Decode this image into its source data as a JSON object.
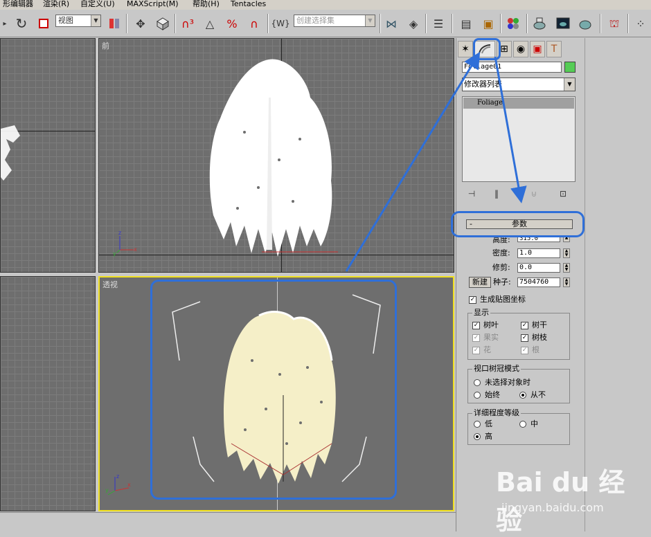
{
  "menubar": {
    "items": [
      "形编辑器",
      "渲染(R)",
      "自定义(U)",
      "MAXScript(M)",
      "帮助(H)",
      "Tentacles"
    ]
  },
  "toolbar": {
    "view_combo": "视图",
    "selection_set_placeholder": "创建选择集",
    "icons": [
      "undo-icon",
      "select-icon",
      "select-by-name-icon",
      "move-icon",
      "rotate-icon",
      "snap-3d-icon",
      "angle-snap-icon",
      "percent-snap-icon",
      "spinner-snap-icon",
      "named-selection-icon",
      "mirror-icon",
      "align-icon",
      "layer-icon",
      "curve-editor-icon",
      "schematic-icon",
      "material-editor-icon",
      "render-setup-icon",
      "render-frame-icon",
      "quick-render-icon",
      "hierarchy-icon",
      "particles-icon"
    ]
  },
  "viewports": {
    "front_label": "前",
    "perspective_label": "透视",
    "active_border_color": "#f0e020",
    "axis_labels": {
      "x": "x",
      "y": "y",
      "z": "z"
    }
  },
  "command_panel": {
    "tabs": [
      "create-tab-icon",
      "modify-tab-icon",
      "hierarchy-tab-icon",
      "motion-tab-icon",
      "display-tab-icon",
      "utilities-tab-icon"
    ],
    "object_name": "Foliage01",
    "object_color": "#55cc55",
    "modifier_list_label": "修改器列表",
    "stack_item": "Foliage",
    "rollout_title": "参数",
    "rollout_minus": "-",
    "params": {
      "height_label": "高度:",
      "height_value": "315.0",
      "density_label": "密度:",
      "density_value": "1.0",
      "pruning_label": "修剪:",
      "pruning_value": "0.0",
      "new_button": "新建",
      "seed_label": "种子:",
      "seed_value": "7504760",
      "gen_mapping_label": "生成贴图坐标"
    },
    "display_group": {
      "title": "显示",
      "leaves": "树叶",
      "trunk": "树干",
      "fruit": "果实",
      "branches": "树枝",
      "flowers": "花",
      "roots": "根"
    },
    "canopy_group": {
      "title": "视口树冠模式",
      "when_not_selected": "未选择对象时",
      "always": "始终",
      "never": "从不"
    },
    "lod_group": {
      "title": "详细程度等级",
      "low": "低",
      "medium": "中",
      "high": "高"
    }
  },
  "annotation": {
    "color": "#2f6fd8"
  },
  "watermark": {
    "logo": "Bai du 经验",
    "url": "jingyan.baidu.com"
  }
}
